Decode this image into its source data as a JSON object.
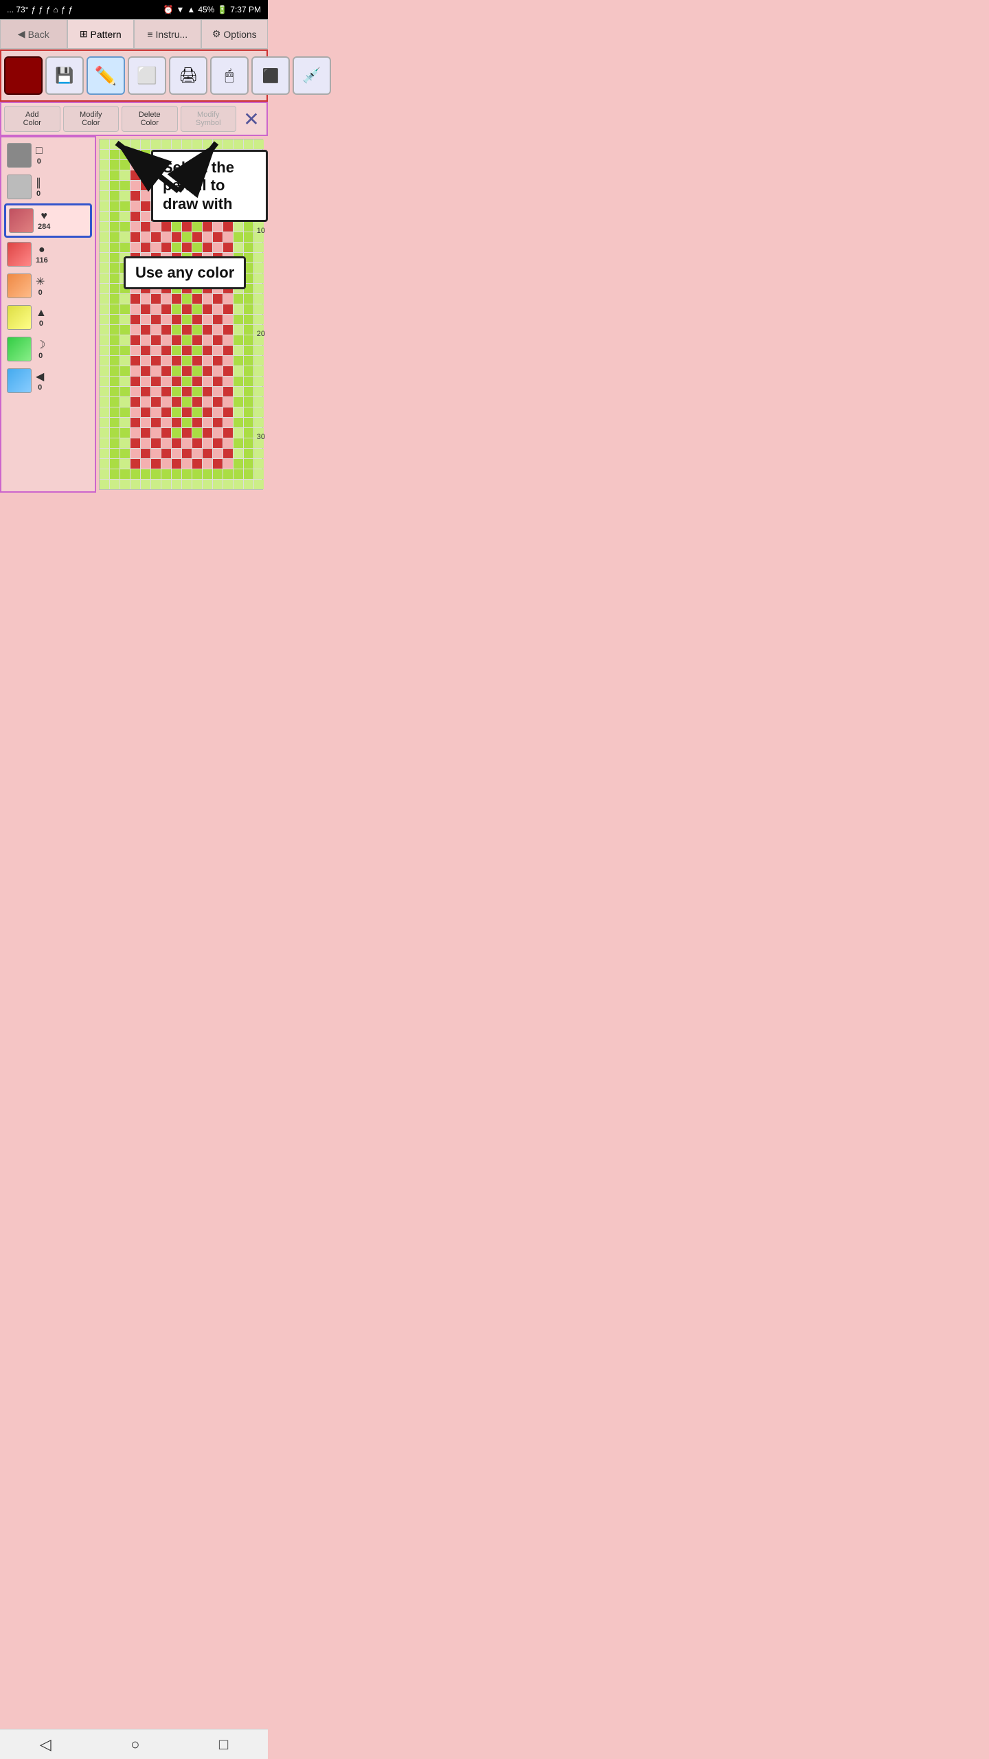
{
  "statusBar": {
    "left": "... 73°",
    "battery": "45%",
    "time": "7:37 PM"
  },
  "navTabs": [
    {
      "id": "back",
      "label": "Back",
      "icon": "◀"
    },
    {
      "id": "pattern",
      "label": "Pattern",
      "icon": "⊞",
      "active": true
    },
    {
      "id": "instructions",
      "label": "Instru...",
      "icon": "≡"
    },
    {
      "id": "options",
      "label": "Options",
      "icon": "⚙"
    }
  ],
  "toolbar": {
    "tools": [
      {
        "id": "color-swatch",
        "icon": "■",
        "color": "#8b0000",
        "type": "color"
      },
      {
        "id": "save",
        "icon": "💾",
        "type": "icon"
      },
      {
        "id": "pencil",
        "icon": "✏",
        "type": "icon",
        "highlighted": true
      },
      {
        "id": "eraser",
        "icon": "⬜",
        "type": "icon"
      },
      {
        "id": "stamp",
        "icon": "📋",
        "type": "icon"
      },
      {
        "id": "fill",
        "icon": "🖨",
        "type": "icon"
      },
      {
        "id": "select",
        "icon": "⬛",
        "type": "icon"
      },
      {
        "id": "eyedropper",
        "icon": "💉",
        "type": "icon"
      }
    ]
  },
  "actionBar": {
    "buttons": [
      {
        "id": "add-color",
        "label": "Add\nColor"
      },
      {
        "id": "modify-color",
        "label": "Modify\nColor"
      },
      {
        "id": "delete-color",
        "label": "Delete\nColor"
      },
      {
        "id": "modify-symbol",
        "label": "Modify\nSymbol",
        "disabled": true
      }
    ],
    "closeLabel": "✕"
  },
  "colors": [
    {
      "id": "gray-dark",
      "hex": "#888888",
      "icon": "□",
      "count": "0"
    },
    {
      "id": "gray-light",
      "hex": "#bbbbbb",
      "icon": "∥",
      "count": "0"
    },
    {
      "id": "red-pink",
      "hex": "#c05060",
      "icon": "♥",
      "count": "284",
      "selected": true
    },
    {
      "id": "red",
      "hex": "#dd4444",
      "icon": "●",
      "count": "116"
    },
    {
      "id": "orange",
      "hex": "#ee8844",
      "icon": "✳",
      "count": "0"
    },
    {
      "id": "yellow",
      "hex": "#eeee44",
      "icon": "▲",
      "count": "0"
    },
    {
      "id": "green",
      "hex": "#33cc44",
      "icon": "☽",
      "count": "0"
    },
    {
      "id": "blue",
      "hex": "#44aaee",
      "icon": "◀",
      "count": "0"
    }
  ],
  "tooltips": {
    "pencil": "Select the pencil\nto draw with",
    "color": "Use any color"
  },
  "gridNumbers": {
    "ten": "10",
    "twenty": "20",
    "thirty": "30"
  },
  "bottomNav": {
    "back": "◁",
    "home": "○",
    "recent": "□"
  }
}
